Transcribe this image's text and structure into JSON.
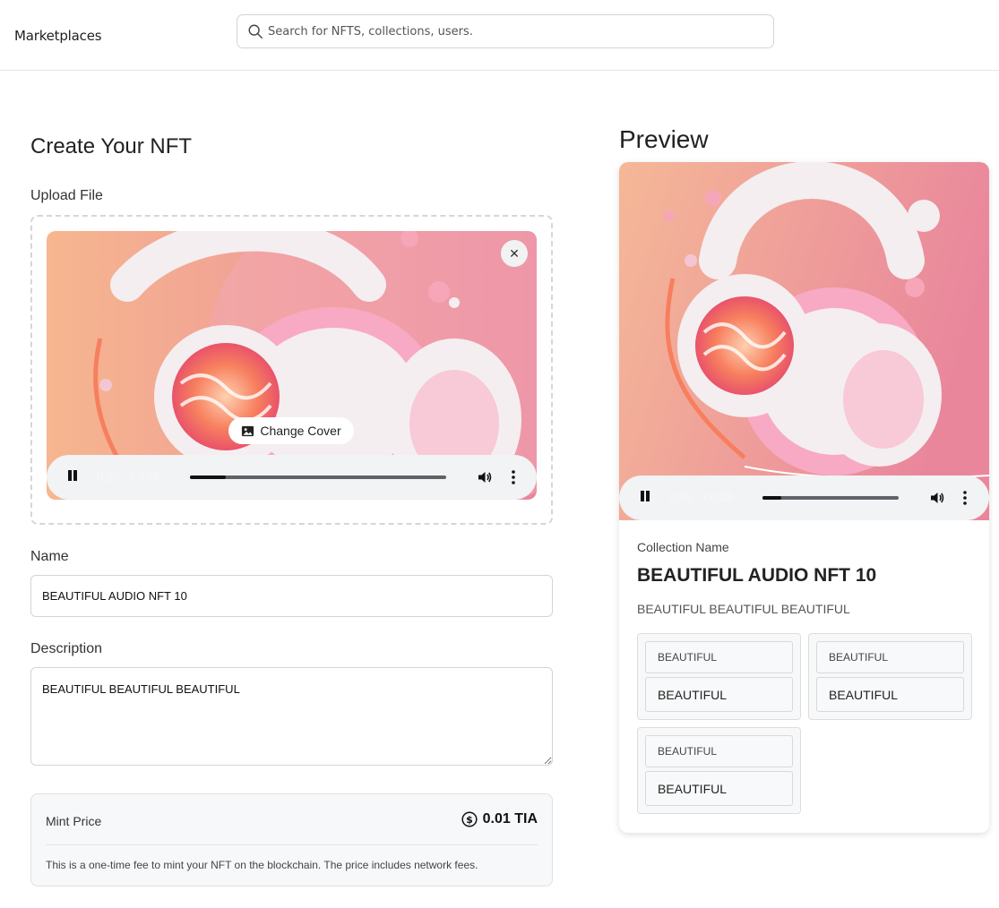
{
  "nav": {
    "brand": "Marketplaces",
    "search_placeholder": "Search for NFTS, collections, users."
  },
  "form": {
    "heading": "Create Your NFT",
    "upload_label": "Upload File",
    "change_cover_label": "Change Cover",
    "close_symbol": "✕",
    "player": {
      "current_time": "0:06",
      "duration": "/ 0:48",
      "progress": 0.14
    },
    "name_label": "Name",
    "name_value": "BEAUTIFUL AUDIO NFT 10",
    "description_label": "Description",
    "description_value": "BEAUTIFUL BEAUTIFUL BEAUTIFUL",
    "mint": {
      "label": "Mint Price",
      "value": "0.01 TIA",
      "note": "This is a one-time fee to mint your NFT on the blockchain. The price includes network fees."
    }
  },
  "preview": {
    "heading": "Preview",
    "player": {
      "current_time": "0:05",
      "duration": "/ 0:48",
      "progress": 0.14
    },
    "collection_label": "Collection Name",
    "title": "BEAUTIFUL AUDIO NFT 10",
    "description": "BEAUTIFUL BEAUTIFUL BEAUTIFUL",
    "attributes": [
      {
        "trait": "BEAUTIFUL",
        "value": "BEAUTIFUL"
      },
      {
        "trait": "BEAUTIFUL",
        "value": "BEAUTIFUL"
      },
      {
        "trait": "BEAUTIFUL",
        "value": "BEAUTIFUL"
      }
    ]
  },
  "colors": {
    "art_bg_left": "#f6b68f",
    "art_bg_right": "#e9869c",
    "headphone_white": "#f4eef0",
    "headphone_pink": "#f8a9c4",
    "player_bg": "#f1f3f4"
  }
}
